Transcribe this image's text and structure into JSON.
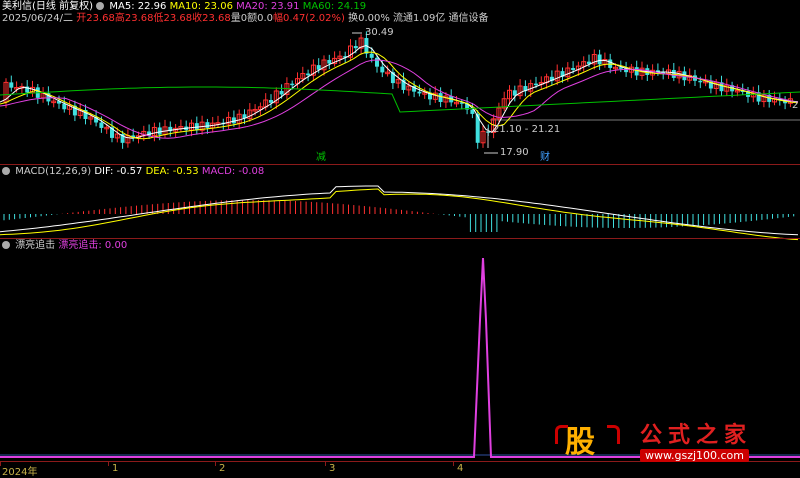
{
  "stock": {
    "name": "美利信",
    "period": "(日线 前复权)"
  },
  "ma": [
    {
      "label": "MA5: 22.96",
      "color": "#ffffff"
    },
    {
      "label": "MA10: 23.06",
      "color": "#ffff00"
    },
    {
      "label": "MA20: 23.91",
      "color": "#e040e0"
    },
    {
      "label": "MA60: 24.19",
      "color": "#00c000"
    }
  ],
  "quote": {
    "date": "2025/06/24/二",
    "open": "开23.68",
    "high": "高23.68",
    "low": "低23.68",
    "close": "收23.68",
    "vol": "量0",
    "amount": "额0.0",
    "change": "幅0.47(2.02%)",
    "turnover": "换0.00%",
    "float": "流通1.09亿",
    "industry": "通信设备"
  },
  "annotations": {
    "high": "30.49",
    "low": "17.90",
    "range": "21.10 - 21.21",
    "right_edge": "2",
    "marker1": "减",
    "marker2": "财"
  },
  "macd": {
    "title": "MACD(12,26,9)",
    "dif": "DIF: -0.57",
    "dea": "DEA: -0.53",
    "macd": "MACD: -0.08"
  },
  "indicator": {
    "title": "漂亮追击",
    "value": "漂亮追击: 0.00"
  },
  "dates": [
    "2024年",
    "1",
    "2",
    "3",
    "4"
  ],
  "watermark": {
    "logo": "股",
    "name": "公式之家",
    "url": "www.gszj100.com"
  },
  "colors": {
    "up": "#ff3030",
    "down": "#40e0e0",
    "separator": "#8b1a1a",
    "indicator": "#e040e0"
  }
}
